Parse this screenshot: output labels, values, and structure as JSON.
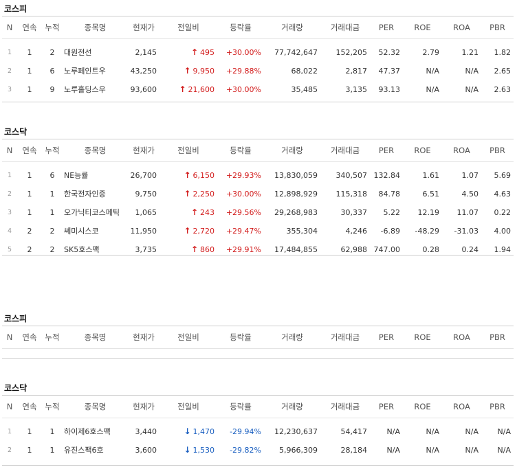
{
  "headers": [
    "N",
    "연속",
    "누적",
    "종목명",
    "현재가",
    "전일비",
    "등락률",
    "거래량",
    "거래대금",
    "PER",
    "ROE",
    "ROA",
    "PBR"
  ],
  "sections": [
    {
      "title": "코스피",
      "rows": [
        {
          "n": "1",
          "cont": "1",
          "acc": "2",
          "name": "대원전선",
          "price": "2,145",
          "dir": "up",
          "diff": "495",
          "rate": "+30.00%",
          "vol": "77,742,647",
          "amt": "152,205",
          "per": "52.32",
          "roe": "2.79",
          "roa": "1.21",
          "pbr": "1.82"
        },
        {
          "n": "2",
          "cont": "1",
          "acc": "6",
          "name": "노루페인트우",
          "price": "43,250",
          "dir": "up",
          "diff": "9,950",
          "rate": "+29.88%",
          "vol": "68,022",
          "amt": "2,817",
          "per": "47.37",
          "roe": "N/A",
          "roa": "N/A",
          "pbr": "2.65"
        },
        {
          "n": "3",
          "cont": "1",
          "acc": "9",
          "name": "노루홀딩스우",
          "price": "93,600",
          "dir": "up",
          "diff": "21,600",
          "rate": "+30.00%",
          "vol": "35,485",
          "amt": "3,135",
          "per": "93.13",
          "roe": "N/A",
          "roa": "N/A",
          "pbr": "2.63"
        }
      ]
    },
    {
      "title": "코스닥",
      "rows": [
        {
          "n": "1",
          "cont": "1",
          "acc": "6",
          "name": "NE능률",
          "price": "26,700",
          "dir": "up",
          "diff": "6,150",
          "rate": "+29.93%",
          "vol": "13,830,059",
          "amt": "340,507",
          "per": "132.84",
          "roe": "1.61",
          "roa": "1.07",
          "pbr": "5.69"
        },
        {
          "n": "2",
          "cont": "1",
          "acc": "1",
          "name": "한국전자인증",
          "price": "9,750",
          "dir": "up",
          "diff": "2,250",
          "rate": "+30.00%",
          "vol": "12,898,929",
          "amt": "115,318",
          "per": "84.78",
          "roe": "6.51",
          "roa": "4.50",
          "pbr": "4.63"
        },
        {
          "n": "3",
          "cont": "1",
          "acc": "1",
          "name": "오가닉티코스메틱",
          "price": "1,065",
          "dir": "up",
          "diff": "243",
          "rate": "+29.56%",
          "vol": "29,268,983",
          "amt": "30,337",
          "per": "5.22",
          "roe": "12.19",
          "roa": "11.07",
          "pbr": "0.22"
        },
        {
          "n": "4",
          "cont": "2",
          "acc": "2",
          "name": "쎄미시스코",
          "price": "11,950",
          "dir": "up",
          "diff": "2,720",
          "rate": "+29.47%",
          "vol": "355,304",
          "amt": "4,246",
          "per": "-6.89",
          "roe": "-48.29",
          "roa": "-31.03",
          "pbr": "4.00"
        },
        {
          "n": "5",
          "cont": "2",
          "acc": "2",
          "name": "SK5호스팩",
          "price": "3,735",
          "dir": "up",
          "diff": "860",
          "rate": "+29.91%",
          "vol": "17,484,855",
          "amt": "62,988",
          "per": "747.00",
          "roe": "0.28",
          "roa": "0.24",
          "pbr": "1.94"
        }
      ]
    },
    {
      "title": "코스피",
      "rows": []
    },
    {
      "title": "코스닥",
      "rows": [
        {
          "n": "1",
          "cont": "1",
          "acc": "1",
          "name": "하이제6호스팩",
          "price": "3,440",
          "dir": "down",
          "diff": "1,470",
          "rate": "-29.94%",
          "vol": "12,230,637",
          "amt": "54,417",
          "per": "N/A",
          "roe": "N/A",
          "roa": "N/A",
          "pbr": "N/A"
        },
        {
          "n": "2",
          "cont": "1",
          "acc": "1",
          "name": "유진스팩6호",
          "price": "3,600",
          "dir": "down",
          "diff": "1,530",
          "rate": "-29.82%",
          "vol": "5,966,309",
          "amt": "28,184",
          "per": "N/A",
          "roe": "N/A",
          "roa": "N/A",
          "pbr": "N/A"
        }
      ]
    }
  ],
  "icons": {
    "up": "arrow-up-icon",
    "down": "arrow-down-icon"
  },
  "colors": {
    "up": "#d21b1b",
    "down": "#1a5fc0"
  }
}
